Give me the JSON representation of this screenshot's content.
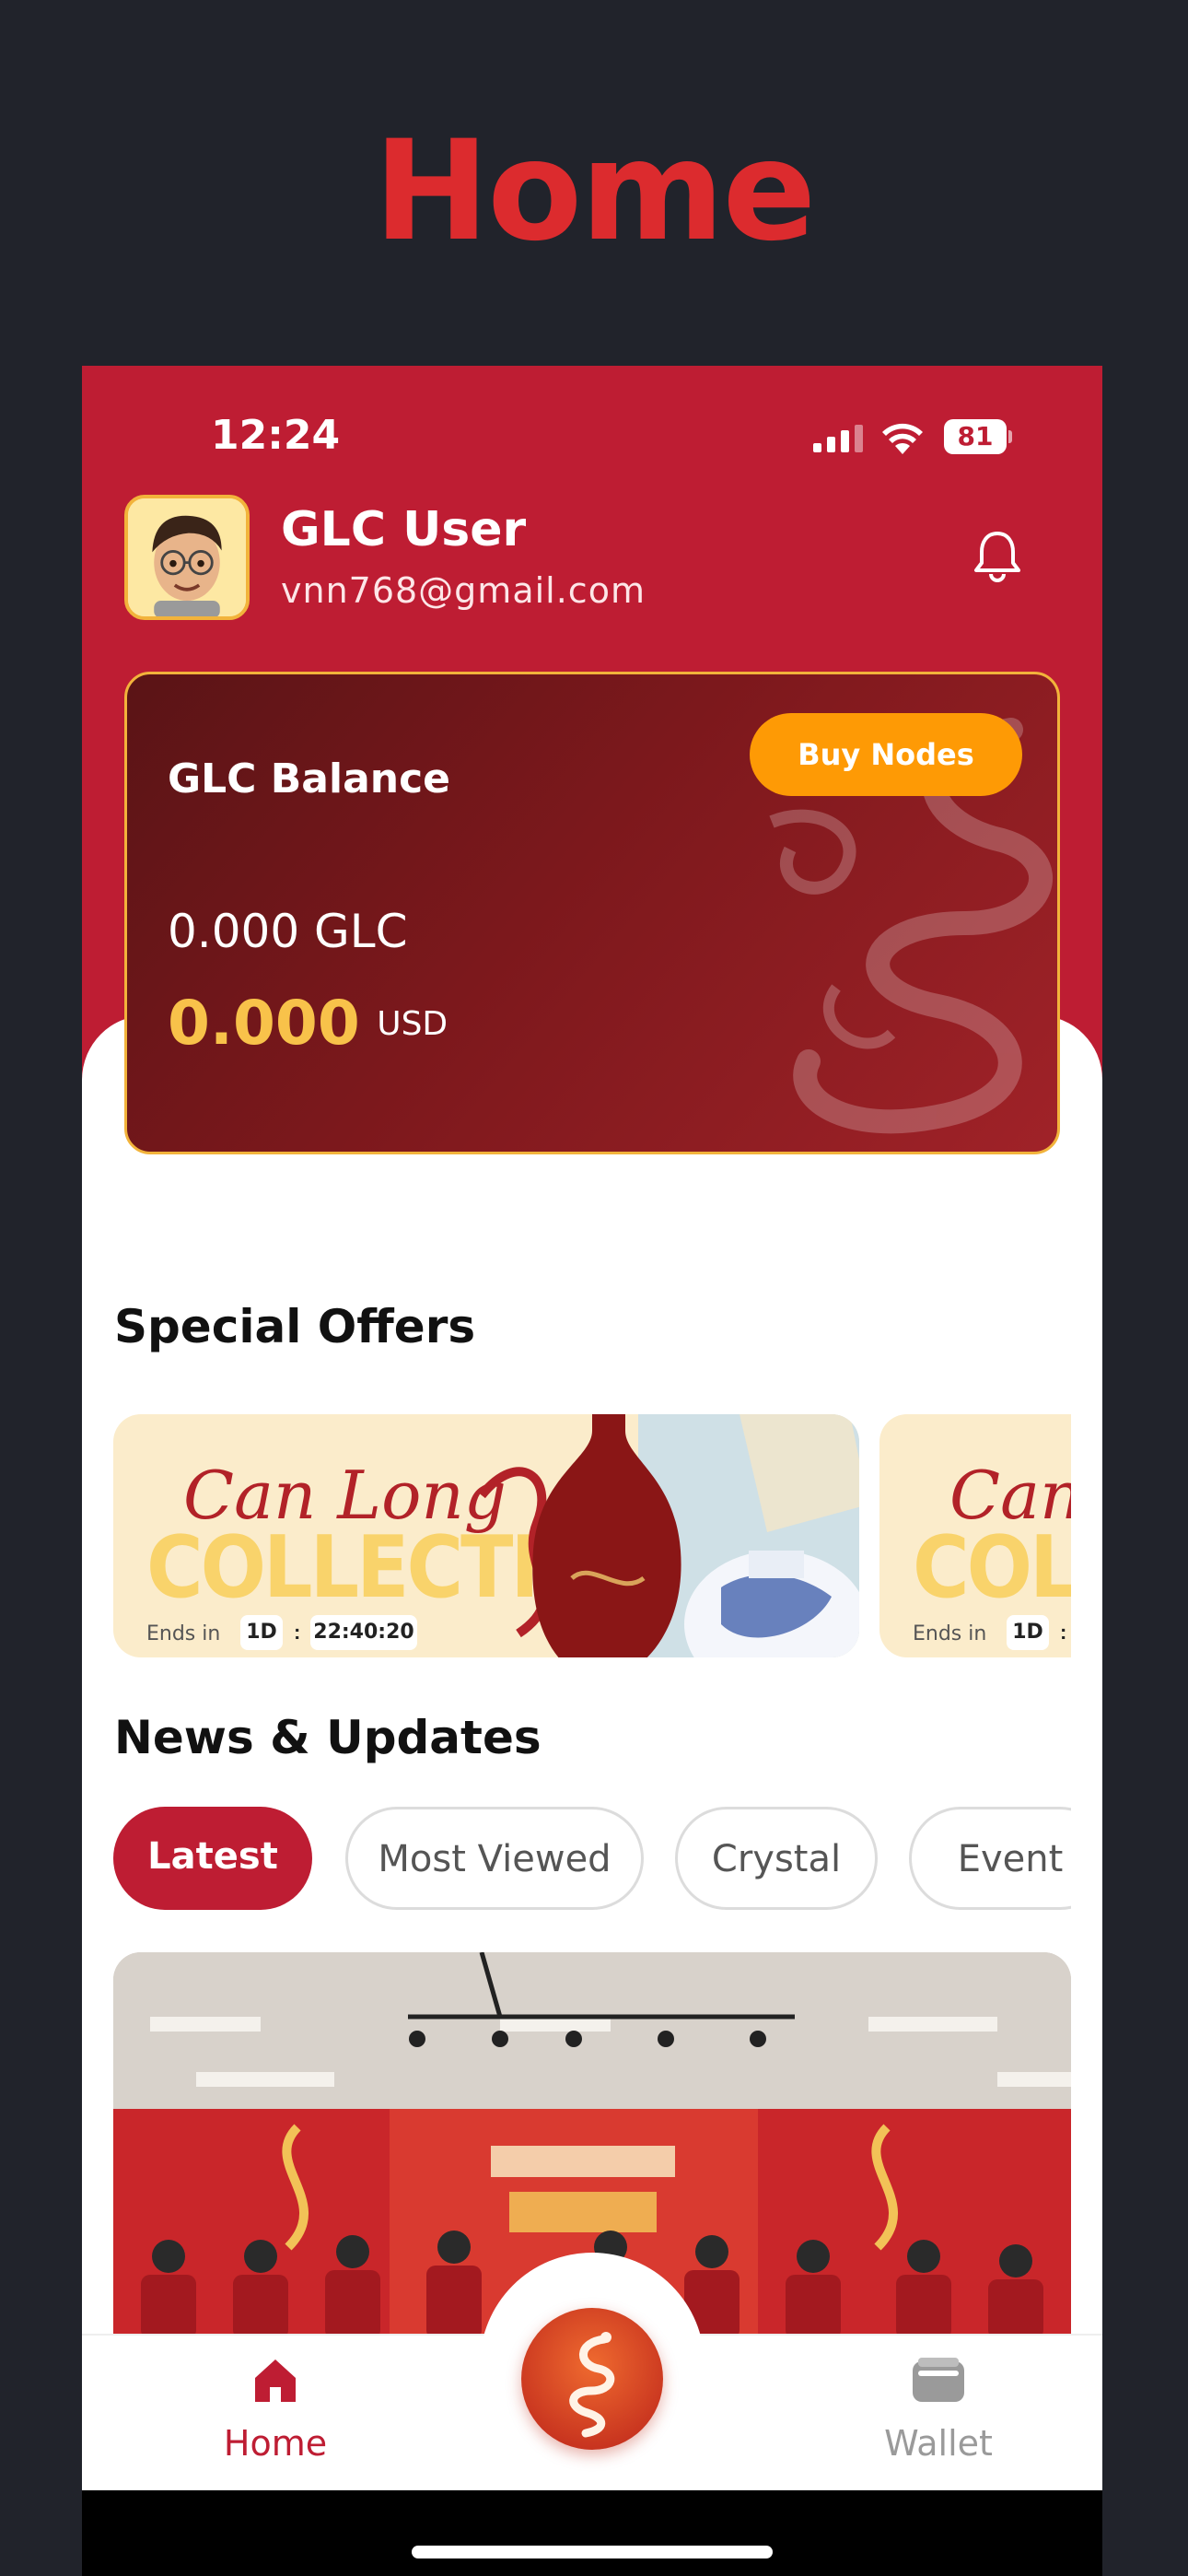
{
  "page_heading": "Home",
  "status_bar": {
    "time": "12:24",
    "battery": "81"
  },
  "user": {
    "name": "GLC User",
    "email": "vnn768@gmail.com"
  },
  "balance": {
    "title": "GLC Balance",
    "buy_label": "Buy Nodes",
    "glc_amount": "0.000 GLC",
    "usd_amount": "0.000",
    "usd_label": "USD"
  },
  "special_offers": {
    "title": "Special Offers",
    "cards": [
      {
        "script_title": "Can Long",
        "collection_title": "COLLECTION",
        "ends_label": "Ends in",
        "days": "1D",
        "time": "22:40:20"
      },
      {
        "script_title": "Can",
        "collection_title": "COLLE",
        "ends_label": "Ends in",
        "days": "1D"
      }
    ]
  },
  "news": {
    "title": "News & Updates",
    "tabs": [
      "Latest",
      "Most Viewed",
      "Crystal",
      "Event"
    ],
    "active_tab": "Latest"
  },
  "bottom_nav": {
    "home_label": "Home",
    "wallet_label": "Wallet"
  },
  "colors": {
    "brand_red": "#be1d33",
    "accent_orange": "#fe9a05",
    "gold": "#f8c24a",
    "heading_red": "#dc2b2e"
  },
  "icons": [
    "signal-icon",
    "wifi-icon",
    "battery-icon",
    "bell-icon",
    "home-icon",
    "wallet-icon",
    "dragon-logo-icon"
  ]
}
